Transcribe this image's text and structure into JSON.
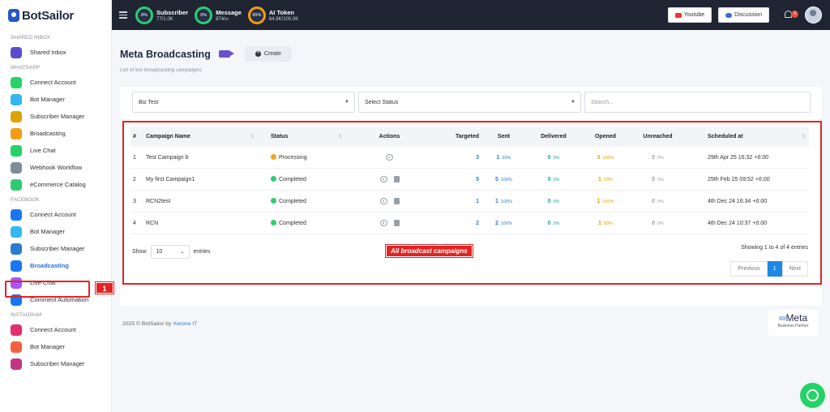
{
  "brand": {
    "name": "BotSailor"
  },
  "sidebar": {
    "sections": [
      {
        "title": "SHARED INBOX",
        "items": [
          {
            "label": "Shared Inbox",
            "icon": "inbox-icon",
            "color": "#5b4bcf"
          }
        ]
      },
      {
        "title": "WHATSAPP",
        "items": [
          {
            "label": "Connect Account",
            "icon": "whatsapp-icon",
            "color": "#25d366"
          },
          {
            "label": "Bot Manager",
            "icon": "robot-icon",
            "color": "#34b7f1"
          },
          {
            "label": "Subscriber Manager",
            "icon": "subscriber-icon",
            "color": "#e0a100"
          },
          {
            "label": "Broadcasting",
            "icon": "megaphone-icon",
            "color": "#f39c12"
          },
          {
            "label": "Live Chat",
            "icon": "chat-icon",
            "color": "#25d366"
          },
          {
            "label": "Webhook Workflow",
            "icon": "webhook-icon",
            "color": "#7f8c9a"
          },
          {
            "label": "eCommerce Catalog",
            "icon": "bag-icon",
            "color": "#2ecc71"
          }
        ]
      },
      {
        "title": "FACEBOOK",
        "items": [
          {
            "label": "Connect Account",
            "icon": "facebook-icon",
            "color": "#1877f2"
          },
          {
            "label": "Bot Manager",
            "icon": "robot-icon",
            "color": "#34b7f1"
          },
          {
            "label": "Subscriber Manager",
            "icon": "subscriber-icon",
            "color": "#2b7bd1"
          },
          {
            "label": "Broadcasting",
            "icon": "megaphone-icon",
            "color": "#1877f2",
            "active": true
          },
          {
            "label": "Live Chat",
            "icon": "messenger-icon",
            "color": "#a855f7"
          },
          {
            "label": "Comment Automation",
            "icon": "comment-icon",
            "color": "#1877f2"
          }
        ]
      },
      {
        "title": "INSTAGRAM",
        "items": [
          {
            "label": "Connect Account",
            "icon": "instagram-icon",
            "color": "#e1306c"
          },
          {
            "label": "Bot Manager",
            "icon": "robot-icon",
            "color": "#f56040"
          },
          {
            "label": "Subscriber Manager",
            "icon": "subscriber-icon",
            "color": "#c13584"
          }
        ]
      }
    ],
    "annotation_number": "1"
  },
  "topbar": {
    "stats": [
      {
        "title": "Subscriber",
        "value": "77/1.0K",
        "percent": "8%",
        "color": "#2ecc71"
      },
      {
        "title": "Message",
        "value": "874/∞",
        "percent": "0%",
        "color": "#2ecc71"
      },
      {
        "title": "AI Token",
        "value": "64.8K/100.0K",
        "percent": "65%",
        "color": "#f39c12"
      }
    ],
    "youtube_label": "Youtube",
    "discussion_label": "Discussion",
    "notification_count": "3"
  },
  "page": {
    "title": "Meta Broadcasting",
    "create_label": "Create",
    "subtitle": "List of bot broadcasting campaigns"
  },
  "filters": {
    "account": "Biz Test",
    "status_placeholder": "Select Status",
    "search_placeholder": "Search..."
  },
  "table": {
    "headers": [
      "#",
      "Campaign Name",
      "Status",
      "Actions",
      "Targeted",
      "Sent",
      "Delivered",
      "Opened",
      "Unreached",
      "Scheduled at"
    ],
    "rows": [
      {
        "num": "1",
        "name": "Test Campaign b",
        "status": "Processing",
        "status_color": "#f5a623",
        "show_delete": false,
        "targeted": "3",
        "sent": "1",
        "sent_pct": "33%",
        "delivered": "0",
        "delivered_pct": "0%",
        "opened": "3",
        "opened_pct": "100%",
        "unreached": "0",
        "unreached_pct": "0%",
        "scheduled": "29th Apr 25 16:32",
        "tz": "+6:00"
      },
      {
        "num": "2",
        "name": "My first Campaign1",
        "status": "Completed",
        "status_color": "#2ecc71",
        "show_delete": true,
        "targeted": "5",
        "sent": "5",
        "sent_pct": "100%",
        "delivered": "0",
        "delivered_pct": "0%",
        "opened": "1",
        "opened_pct": "20%",
        "unreached": "0",
        "unreached_pct": "0%",
        "scheduled": "25th Feb 25 09:52",
        "tz": "+6:00"
      },
      {
        "num": "3",
        "name": "RCN2test",
        "status": "Completed",
        "status_color": "#2ecc71",
        "show_delete": true,
        "targeted": "1",
        "sent": "1",
        "sent_pct": "100%",
        "delivered": "0",
        "delivered_pct": "0%",
        "opened": "1",
        "opened_pct": "100%",
        "unreached": "0",
        "unreached_pct": "0%",
        "scheduled": "4th Dec 24 16:34",
        "tz": "+6:00"
      },
      {
        "num": "4",
        "name": "RCN",
        "status": "Completed",
        "status_color": "#2ecc71",
        "show_delete": true,
        "targeted": "2",
        "sent": "2",
        "sent_pct": "100%",
        "delivered": "0",
        "delivered_pct": "0%",
        "opened": "1",
        "opened_pct": "50%",
        "unreached": "0",
        "unreached_pct": "0%",
        "scheduled": "4th Dec 24 10:37",
        "tz": "+6:00"
      }
    ]
  },
  "table_footer": {
    "show_label": "Show",
    "entries_value": "10",
    "entries_label": "entries",
    "callout": "All broadcast campaigns",
    "showing_text": "Showing 1 to 4 of 4 entries",
    "previous_label": "Previous",
    "page": "1",
    "next_label": "Next"
  },
  "footer": {
    "copyright": "2025 © BotSailor by ",
    "company": "Xerone IT",
    "meta_logo": "Meta",
    "meta_partner": "Business Partner"
  }
}
